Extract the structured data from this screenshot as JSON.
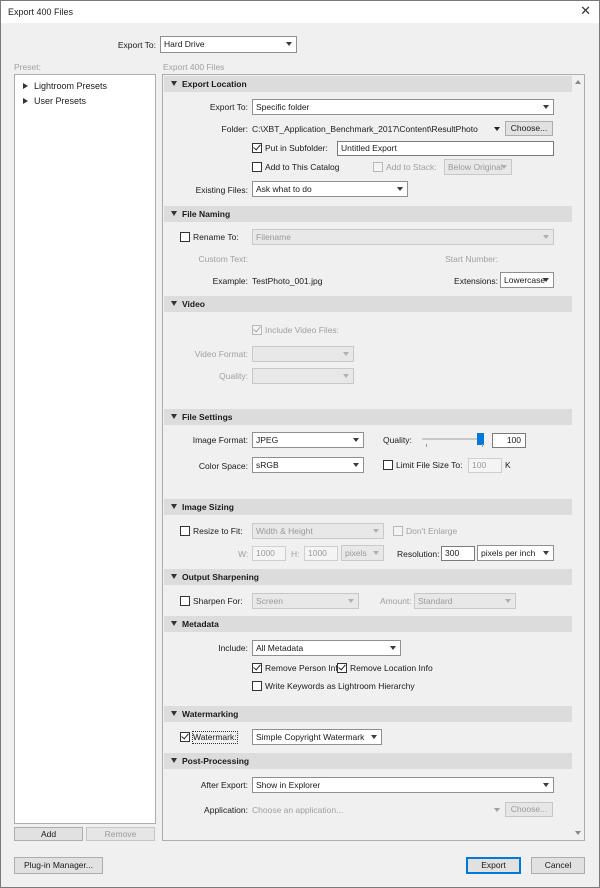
{
  "window": {
    "title": "Export 400 Files",
    "close_glyph": "✕"
  },
  "export_to": {
    "label": "Export To:",
    "value": "Hard Drive"
  },
  "preset": {
    "label": "Preset:",
    "items": [
      {
        "label": "Lightroom Presets"
      },
      {
        "label": "User Presets"
      }
    ],
    "add_label": "Add",
    "remove_label": "Remove"
  },
  "subheader": "Export 400 Files",
  "sections": {
    "export_location": {
      "title": "Export Location",
      "export_to_label": "Export To:",
      "export_to_value": "Specific folder",
      "folder_label": "Folder:",
      "folder_path": "C:\\XBT_Application_Benchmark_2017\\Content\\ResultPhoto",
      "choose_label": "Choose...",
      "put_in_subfolder_label": "Put in Subfolder:",
      "put_in_subfolder_checked": true,
      "subfolder_value": "Untitled Export",
      "add_to_catalog_label": "Add to This Catalog",
      "add_to_stack_label": "Add to Stack:",
      "stack_value": "Below Original",
      "existing_files_label": "Existing Files:",
      "existing_files_value": "Ask what to do"
    },
    "file_naming": {
      "title": "File Naming",
      "rename_to_label": "Rename To:",
      "rename_value": "Filename",
      "custom_text_label": "Custom Text:",
      "start_number_label": "Start Number:",
      "example_label": "Example:",
      "example_value": "TestPhoto_001.jpg",
      "extensions_label": "Extensions:",
      "extensions_value": "Lowercase"
    },
    "video": {
      "title": "Video",
      "include_video_label": "Include Video Files:",
      "video_format_label": "Video Format:",
      "quality_label": "Quality:"
    },
    "file_settings": {
      "title": "File Settings",
      "image_format_label": "Image Format:",
      "image_format_value": "JPEG",
      "quality_label": "Quality:",
      "quality_value": "100",
      "quality_fraction": 1.0,
      "color_space_label": "Color Space:",
      "color_space_value": "sRGB",
      "limit_size_label": "Limit File Size To:",
      "limit_size_value": "100",
      "limit_size_unit": "K"
    },
    "image_sizing": {
      "title": "Image Sizing",
      "resize_label": "Resize to Fit:",
      "resize_value": "Width & Height",
      "dont_enlarge_label": "Don't Enlarge",
      "w_label": "W:",
      "w_value": "1000",
      "h_label": "H:",
      "h_value": "1000",
      "unit_value": "pixels",
      "resolution_label": "Resolution:",
      "resolution_value": "300",
      "resolution_unit": "pixels per inch"
    },
    "output_sharpening": {
      "title": "Output Sharpening",
      "sharpen_label": "Sharpen For:",
      "sharpen_value": "Screen",
      "amount_label": "Amount:",
      "amount_value": "Standard"
    },
    "metadata": {
      "title": "Metadata",
      "include_label": "Include:",
      "include_value": "All Metadata",
      "remove_person_label": "Remove Person Info",
      "remove_location_label": "Remove Location Info",
      "write_keywords_label": "Write Keywords as Lightroom Hierarchy"
    },
    "watermarking": {
      "title": "Watermarking",
      "watermark_label": "Watermark:",
      "watermark_value": "Simple Copyright Watermark"
    },
    "post_processing": {
      "title": "Post-Processing",
      "after_export_label": "After Export:",
      "after_export_value": "Show in Explorer",
      "application_label": "Application:",
      "application_placeholder": "Choose an application...",
      "choose_label": "Choose..."
    }
  },
  "footer": {
    "plugin_manager_label": "Plug-in Manager...",
    "export_label": "Export",
    "cancel_label": "Cancel"
  }
}
